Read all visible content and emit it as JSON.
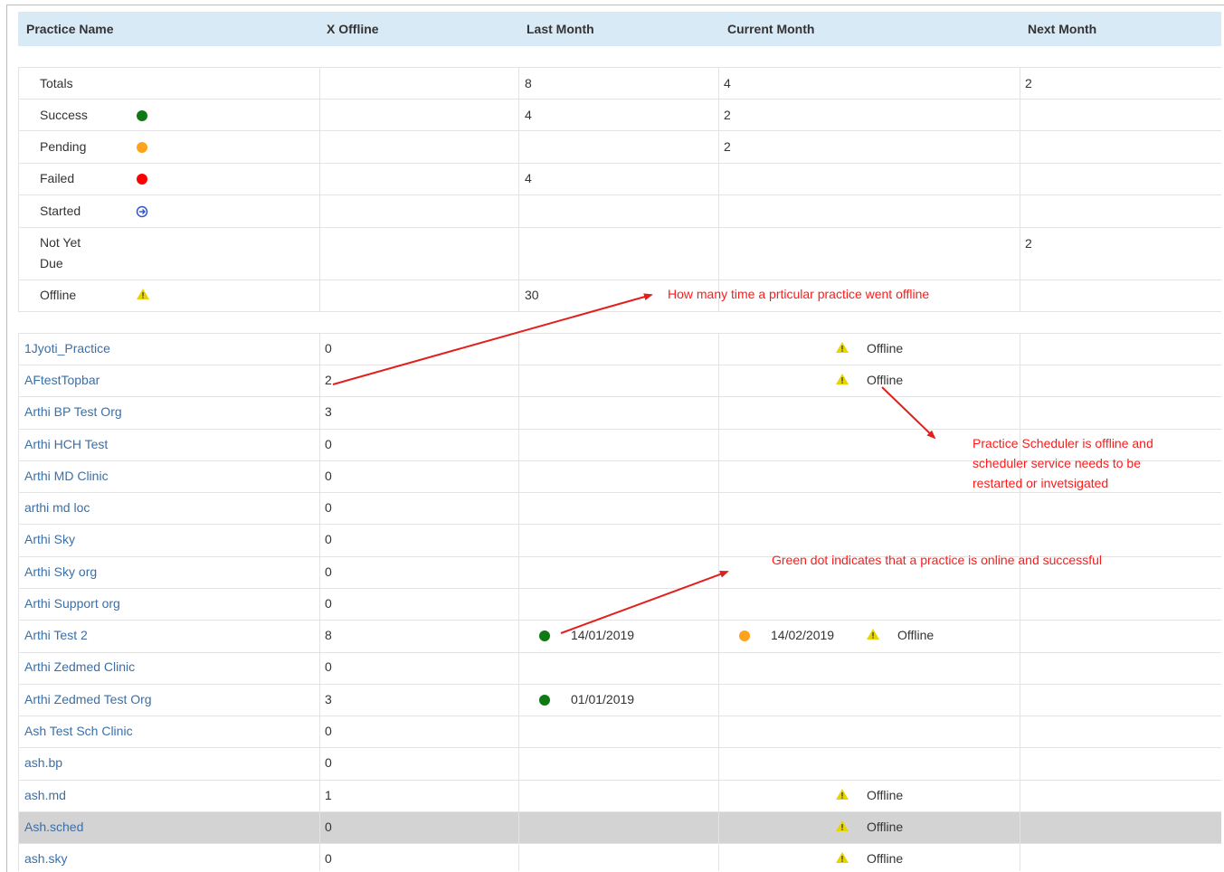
{
  "columns": {
    "practice_name": "Practice Name",
    "x_offline": "X Offline",
    "last_month": "Last Month",
    "current_month": "Current Month",
    "next_month": "Next Month"
  },
  "summary": [
    {
      "label": "Totals",
      "icon": "",
      "last": "8",
      "current": "4",
      "next": "2"
    },
    {
      "label": "Success",
      "icon": "green-dot",
      "last": "4",
      "current": "2",
      "next": ""
    },
    {
      "label": "Pending",
      "icon": "orange-dot",
      "last": "",
      "current": "2",
      "next": ""
    },
    {
      "label": "Failed",
      "icon": "red-dot",
      "last": "4",
      "current": "",
      "next": ""
    },
    {
      "label": "Started",
      "icon": "blue-circle-arrow",
      "last": "",
      "current": "",
      "next": ""
    },
    {
      "label_line1": "Not Yet",
      "label_line2": "Due",
      "icon": "",
      "last": "",
      "current": "",
      "next": "2"
    },
    {
      "label": "Offline",
      "icon": "warning-triangle",
      "last": "30",
      "current": "",
      "next": ""
    }
  ],
  "status": {
    "offline": "Offline"
  },
  "practices": [
    {
      "name": "1Jyoti_Practice",
      "x_offline": "0",
      "current_status": "Offline"
    },
    {
      "name": "AFtestTopbar",
      "x_offline": "2",
      "current_status": "Offline"
    },
    {
      "name": "Arthi BP Test Org",
      "x_offline": "3"
    },
    {
      "name": "Arthi HCH Test",
      "x_offline": "0"
    },
    {
      "name": "Arthi MD Clinic",
      "x_offline": "0"
    },
    {
      "name": "arthi md loc",
      "x_offline": "0"
    },
    {
      "name": "Arthi Sky",
      "x_offline": "0"
    },
    {
      "name": "Arthi Sky org",
      "x_offline": "0"
    },
    {
      "name": "Arthi Support org",
      "x_offline": "0"
    },
    {
      "name": "Arthi Test 2",
      "x_offline": "8",
      "last_date": "14/01/2019",
      "current_date": "14/02/2019",
      "current_status": "Offline"
    },
    {
      "name": "Arthi Zedmed Clinic",
      "x_offline": "0"
    },
    {
      "name": "Arthi Zedmed Test Org",
      "x_offline": "3",
      "last_date": "01/01/2019"
    },
    {
      "name": "Ash Test Sch Clinic",
      "x_offline": "0"
    },
    {
      "name": "ash.bp",
      "x_offline": "0"
    },
    {
      "name": "ash.md",
      "x_offline": "1",
      "current_status": "Offline"
    },
    {
      "name": "Ash.sched",
      "x_offline": "0",
      "current_status": "Offline",
      "highlighted": true
    },
    {
      "name": "ash.sky",
      "x_offline": "0",
      "current_status": "Offline"
    }
  ],
  "annotations": {
    "offline_count": "How many time a prticular practice went offline",
    "scheduler_line1": "Practice Scheduler is offline and",
    "scheduler_line2": "scheduler service needs to be",
    "scheduler_line3": "restarted or invetsigated",
    "green_dot": "Green dot indicates that a practice is online and successful"
  },
  "colors": {
    "header_bg": "#d9eaf7",
    "link": "#3a6fa8",
    "success": "#0f7a14",
    "pending": "#ffa31a",
    "failed": "#ff0000",
    "started": "#3355cc",
    "warning": "#e8d400",
    "annotation": "#ff1a1a",
    "highlight_row": "#d3d3d3"
  }
}
